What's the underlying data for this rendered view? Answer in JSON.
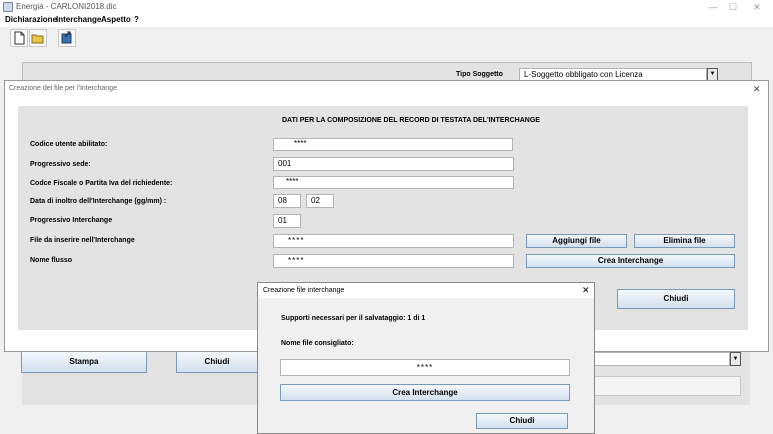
{
  "window": {
    "title": "Energia - CARLONI2018.dic",
    "min": "—",
    "max": "☐",
    "close": "✕"
  },
  "menu": [
    "Dichiarazione",
    "Interchange",
    "Aspetto",
    "?"
  ],
  "background": {
    "tipo_soggetto_label": "Tipo Soggetto",
    "tipo_soggetto_value": "L-Soggetto obbligato con Licenza",
    "stampa": "Stampa",
    "chiudi": "Chiudi",
    "dropdown_glyph": "▼"
  },
  "dialog1": {
    "title": "Creazione dei file per l'Interchange",
    "close": "✕",
    "header": "DATI PER LA COMPOSIZIONE DEL RECORD DI TESTATA DEL'INTERCHANGE",
    "fields": {
      "codice_label": "Codice utente abilitato:",
      "codice_value": "****",
      "progressivo_sede_label": "Progressivo sede:",
      "progressivo_sede_value": "001",
      "codice_fiscale_label": "Codce Fiscale o Partita Iva del richiedente:",
      "codice_fiscale_value": "****",
      "data_label": "Data di inoltro dell'Interchange (gg/mm) :",
      "data_gg": "08",
      "data_mm": "02",
      "progressivo_interchange_label": "Progressivo Interchange",
      "progressivo_interchange_value": "01",
      "file_label": "File da inserire nell'Interchange",
      "file_value": "****",
      "nome_flusso_label": "Nome flusso",
      "nome_flusso_value": "****"
    },
    "buttons": {
      "aggiungi": "Aggiungi file",
      "elimina": "Elimina file",
      "crea": "Crea Interchange",
      "chiudi": "Chiudi"
    }
  },
  "dialog2": {
    "title": "Creazione file interchange",
    "close": "✕",
    "supporti": "Supporti necessari per il salvataggio: 1 di 1",
    "nome_label": "Nome file consigliato:",
    "nome_value": "****",
    "crea": "Crea Interchange",
    "chiudi": "Chiudi"
  }
}
